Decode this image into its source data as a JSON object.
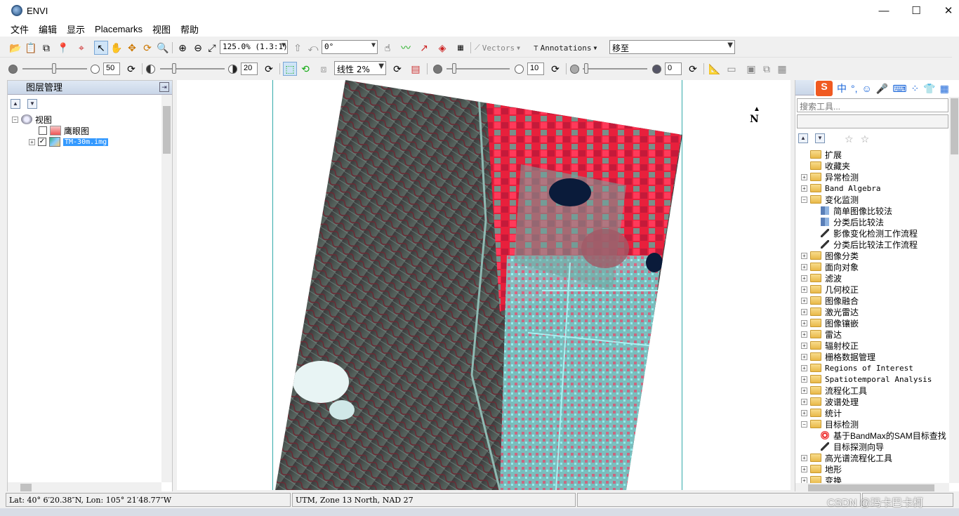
{
  "window": {
    "title": "ENVI",
    "controls": {
      "minimize": "—",
      "maximize": "☐",
      "close": "✕"
    }
  },
  "menu": [
    "文件",
    "编辑",
    "显示",
    "Placemarks",
    "视图",
    "帮助"
  ],
  "toolbar1": {
    "zoom_value": "125.0% (1.3:1)",
    "rotation_value": "0°",
    "vectors_label": "Vectors",
    "annotations_label": "Annotations",
    "goto_value": "移至"
  },
  "toolbar2": {
    "brightness_value": "50",
    "contrast_value": "20",
    "stretch_value": "线性 2%",
    "sharpen_value": "10",
    "transparency_value": "0"
  },
  "layer_manager": {
    "title": "图层管理",
    "root_label": "视图",
    "items": [
      {
        "label": "鹰眼图",
        "checked": false,
        "selected": false
      },
      {
        "label": "TM-30m.img",
        "checked": true,
        "selected": true
      }
    ]
  },
  "view": {
    "north_label": "N"
  },
  "toolbox": {
    "search_placeholder": "搜索工具...",
    "items": [
      {
        "label": "扩展",
        "type": "folder",
        "level": 0,
        "expand": ""
      },
      {
        "label": "收藏夹",
        "type": "folder",
        "level": 0,
        "expand": ""
      },
      {
        "label": "异常检测",
        "type": "folder",
        "level": 0,
        "expand": "+"
      },
      {
        "label": "Band Algebra",
        "type": "folder",
        "level": 0,
        "expand": "+"
      },
      {
        "label": "变化监测",
        "type": "folder",
        "level": 0,
        "expand": "−"
      },
      {
        "label": "简单图像比较法",
        "type": "tool",
        "level": 1,
        "expand": ""
      },
      {
        "label": "分类后比较法",
        "type": "tool",
        "level": 1,
        "expand": ""
      },
      {
        "label": "影像变化检测工作流程",
        "type": "wand",
        "level": 1,
        "expand": ""
      },
      {
        "label": "分类后比较法工作流程",
        "type": "wand",
        "level": 1,
        "expand": ""
      },
      {
        "label": "图像分类",
        "type": "folder",
        "level": 0,
        "expand": "+"
      },
      {
        "label": "面向对象",
        "type": "folder",
        "level": 0,
        "expand": "+"
      },
      {
        "label": "滤波",
        "type": "folder",
        "level": 0,
        "expand": "+"
      },
      {
        "label": "几何校正",
        "type": "folder",
        "level": 0,
        "expand": "+"
      },
      {
        "label": "图像融合",
        "type": "folder",
        "level": 0,
        "expand": "+"
      },
      {
        "label": "激光雷达",
        "type": "folder",
        "level": 0,
        "expand": "+"
      },
      {
        "label": "图像镶嵌",
        "type": "folder",
        "level": 0,
        "expand": "+"
      },
      {
        "label": "雷达",
        "type": "folder",
        "level": 0,
        "expand": "+"
      },
      {
        "label": "辐射校正",
        "type": "folder",
        "level": 0,
        "expand": "+"
      },
      {
        "label": "栅格数据管理",
        "type": "folder",
        "level": 0,
        "expand": "+"
      },
      {
        "label": "Regions of Interest",
        "type": "folder",
        "level": 0,
        "expand": "+"
      },
      {
        "label": "Spatiotemporal Analysis",
        "type": "folder",
        "level": 0,
        "expand": "+"
      },
      {
        "label": "流程化工具",
        "type": "folder",
        "level": 0,
        "expand": "+"
      },
      {
        "label": "波谱处理",
        "type": "folder",
        "level": 0,
        "expand": "+"
      },
      {
        "label": "统计",
        "type": "folder",
        "level": 0,
        "expand": "+"
      },
      {
        "label": "目标检测",
        "type": "folder",
        "level": 0,
        "expand": "−"
      },
      {
        "label": "基于BandMax的SAM目标查找",
        "type": "target",
        "level": 1,
        "expand": ""
      },
      {
        "label": "目标探测向导",
        "type": "wand",
        "level": 1,
        "expand": ""
      },
      {
        "label": "高光谱流程化工具",
        "type": "folder",
        "level": 0,
        "expand": "+"
      },
      {
        "label": "地形",
        "type": "folder",
        "level": 0,
        "expand": "+"
      },
      {
        "label": "变换",
        "type": "folder",
        "level": 0,
        "expand": "+"
      }
    ]
  },
  "status": {
    "latlon": "Lat: 40° 6′20.38″N, Lon: 105° 21′48.77″W",
    "projection": "UTM, Zone 13 North, NAD 27",
    "watermark": "CSDN @玛卡巴卡柯"
  },
  "colors": {
    "selection": "#3399ff",
    "image_vegetation": "#e8203c",
    "image_urban": "#5ce6e6"
  }
}
